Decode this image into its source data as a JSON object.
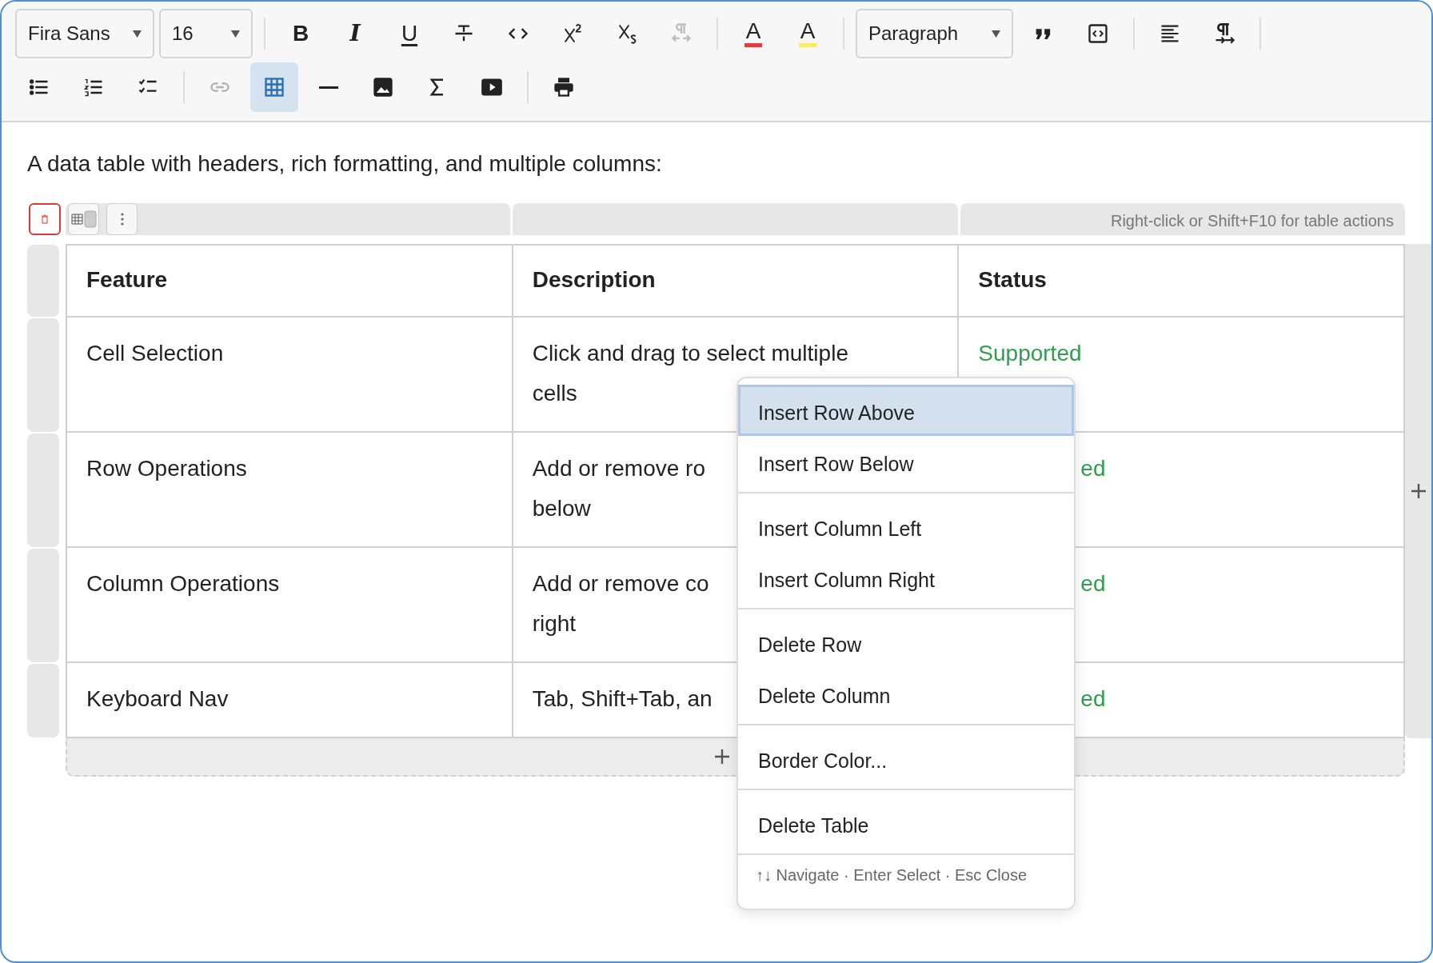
{
  "toolbar": {
    "rows": [
      {
        "items": [
          {
            "kind": "font-select",
            "value": "Fira Sans"
          },
          {
            "kind": "size-select",
            "value": "16"
          },
          {
            "kind": "separator"
          },
          {
            "kind": "bold",
            "label": "B",
            "disabled": false,
            "selected": false
          },
          {
            "kind": "italic",
            "label": "I",
            "disabled": false,
            "selected": false
          },
          {
            "kind": "underline",
            "label": "U",
            "disabled": false,
            "selected": false
          },
          {
            "kind": "strikethrough",
            "disabled": false,
            "selected": false
          },
          {
            "kind": "code",
            "disabled": false,
            "selected": false
          },
          {
            "kind": "superscript",
            "disabled": false,
            "selected": false
          },
          {
            "kind": "subscript",
            "disabled": false,
            "selected": false
          },
          {
            "kind": "direction",
            "disabled": true,
            "selected": false
          },
          {
            "kind": "separator"
          },
          {
            "kind": "text-color",
            "label": "A",
            "color": "#e03e3e",
            "disabled": false,
            "selected": false
          },
          {
            "kind": "highlight",
            "label": "A",
            "color": "#f7e96b",
            "disabled": false,
            "selected": false
          },
          {
            "kind": "separator"
          },
          {
            "kind": "block-select",
            "value": "Paragraph"
          },
          {
            "kind": "quote",
            "disabled": false,
            "selected": false
          },
          {
            "kind": "code-block",
            "disabled": false,
            "selected": false
          },
          {
            "kind": "separator"
          },
          {
            "kind": "align-left",
            "disabled": false,
            "selected": false
          },
          {
            "kind": "pilcrow",
            "disabled": false,
            "selected": false
          },
          {
            "kind": "separator"
          }
        ]
      },
      {
        "items": [
          {
            "kind": "bullet-list",
            "disabled": false,
            "selected": false
          },
          {
            "kind": "numbered-list",
            "disabled": false,
            "selected": false
          },
          {
            "kind": "checklist",
            "disabled": false,
            "selected": false
          },
          {
            "kind": "separator"
          },
          {
            "kind": "link",
            "disabled": true,
            "selected": false
          },
          {
            "kind": "table",
            "disabled": false,
            "selected": true
          },
          {
            "kind": "rule",
            "disabled": false,
            "selected": false
          },
          {
            "kind": "image",
            "disabled": false,
            "selected": false
          },
          {
            "kind": "sigma",
            "disabled": false,
            "selected": false
          },
          {
            "kind": "video",
            "disabled": false,
            "selected": false
          },
          {
            "kind": "separator"
          },
          {
            "kind": "print",
            "disabled": false,
            "selected": false
          }
        ]
      }
    ]
  },
  "intro": "A data table with headers, rich formatting, and multiple columns:",
  "table": {
    "hint": "Right-click or Shift+F10 for table actions",
    "columns": [
      "Feature",
      "Description",
      "Status"
    ],
    "rows": [
      {
        "feature": "Cell Selection",
        "description": [
          "Click and drag to select multiple",
          "cells"
        ],
        "status": {
          "text": "Supported"
        }
      },
      {
        "feature": "Row Operations",
        "description": [
          "Add or remove ro",
          "below"
        ],
        "status": {
          "text": "ed"
        }
      },
      {
        "feature": "Column Operations",
        "description": [
          "Add or remove co",
          "right"
        ],
        "status": {
          "text": "ed"
        }
      },
      {
        "feature": "Keyboard Nav",
        "description": [
          "Tab, Shift+Tab, an"
        ],
        "status": {
          "text": "ed"
        }
      }
    ]
  },
  "context_menu": {
    "groups": [
      {
        "items": [
          {
            "label": "Insert Row Above",
            "selected": true
          },
          {
            "label": "Insert Row Below",
            "selected": false
          }
        ]
      },
      {
        "items": [
          {
            "label": "Insert Column Left",
            "selected": false
          },
          {
            "label": "Insert Column Right",
            "selected": false
          }
        ]
      },
      {
        "items": [
          {
            "label": "Delete Row",
            "selected": false
          },
          {
            "label": "Delete Column",
            "selected": false
          }
        ]
      },
      {
        "items": [
          {
            "label": "Border Color...",
            "selected": false
          }
        ]
      },
      {
        "items": [
          {
            "label": "Delete Table",
            "selected": false
          }
        ]
      }
    ],
    "footer": "↑↓ Navigate · Enter Select · Esc Close"
  }
}
